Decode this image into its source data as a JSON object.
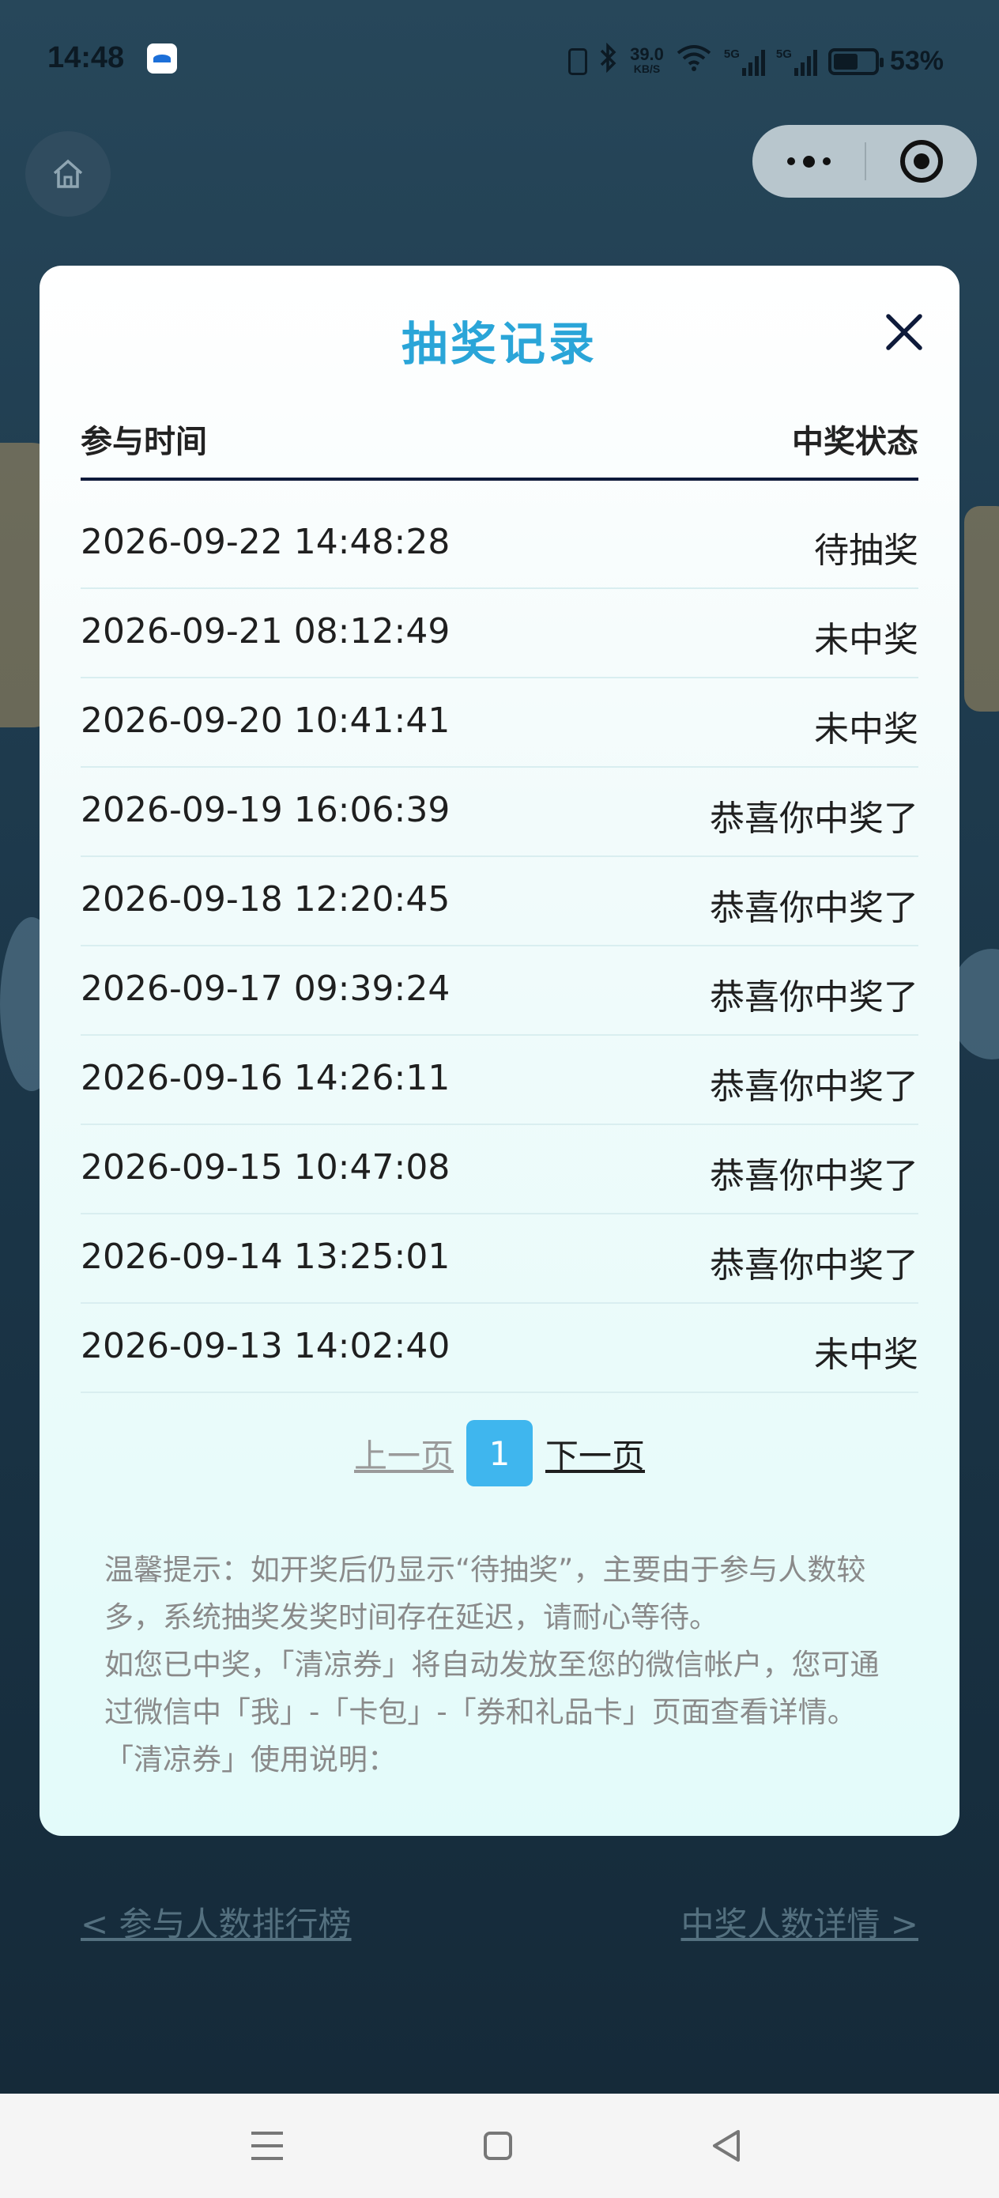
{
  "status_bar": {
    "time": "14:48",
    "net_speed_value": "39.0",
    "net_speed_unit": "KB/S",
    "signal1_label": "5G",
    "signal2_label": "5G",
    "battery": "53%"
  },
  "modal": {
    "title": "抽奖记录",
    "columns": {
      "time": "参与时间",
      "status": "中奖状态"
    },
    "records": [
      {
        "time": "2026-09-22 14:48:28",
        "status": "待抽奖"
      },
      {
        "time": "2026-09-21 08:12:49",
        "status": "未中奖"
      },
      {
        "time": "2026-09-20 10:41:41",
        "status": "未中奖"
      },
      {
        "time": "2026-09-19 16:06:39",
        "status": "恭喜你中奖了"
      },
      {
        "time": "2026-09-18 12:20:45",
        "status": "恭喜你中奖了"
      },
      {
        "time": "2026-09-17 09:39:24",
        "status": "恭喜你中奖了"
      },
      {
        "time": "2026-09-16 14:26:11",
        "status": "恭喜你中奖了"
      },
      {
        "time": "2026-09-15 10:47:08",
        "status": "恭喜你中奖了"
      },
      {
        "time": "2026-09-14 13:25:01",
        "status": "恭喜你中奖了"
      },
      {
        "time": "2026-09-13 14:02:40",
        "status": "未中奖"
      }
    ],
    "pagination": {
      "prev": "上一页",
      "current": "1",
      "next": "下一页"
    },
    "tips": [
      "温馨提示：如开奖后仍显示“待抽奖”，主要由于参与人数较多，系统抽奖发奖时间存在延迟，请耐心等待。",
      "如您已中奖，「清凉券」将自动发放至您的微信帐户，您可通过微信中「我」-「卡包」-「券和礼品卡」页面查看详情。",
      "「清凉券」使用说明："
    ]
  },
  "background_links": {
    "leaderboard": "< 参与人数排行榜",
    "winners_detail": "中奖人数详情 >"
  },
  "colors": {
    "accent": "#2aa5d8",
    "page_active": "#3fb6ee",
    "header_rule": "#0e1a3a"
  },
  "icons": {
    "home": "home-icon",
    "more": "more-dots-icon",
    "close_miniprogram": "target-icon",
    "modal_close": "close-icon",
    "nav_menu": "menu-icon",
    "nav_home": "square-icon",
    "nav_back": "back-triangle-icon"
  }
}
